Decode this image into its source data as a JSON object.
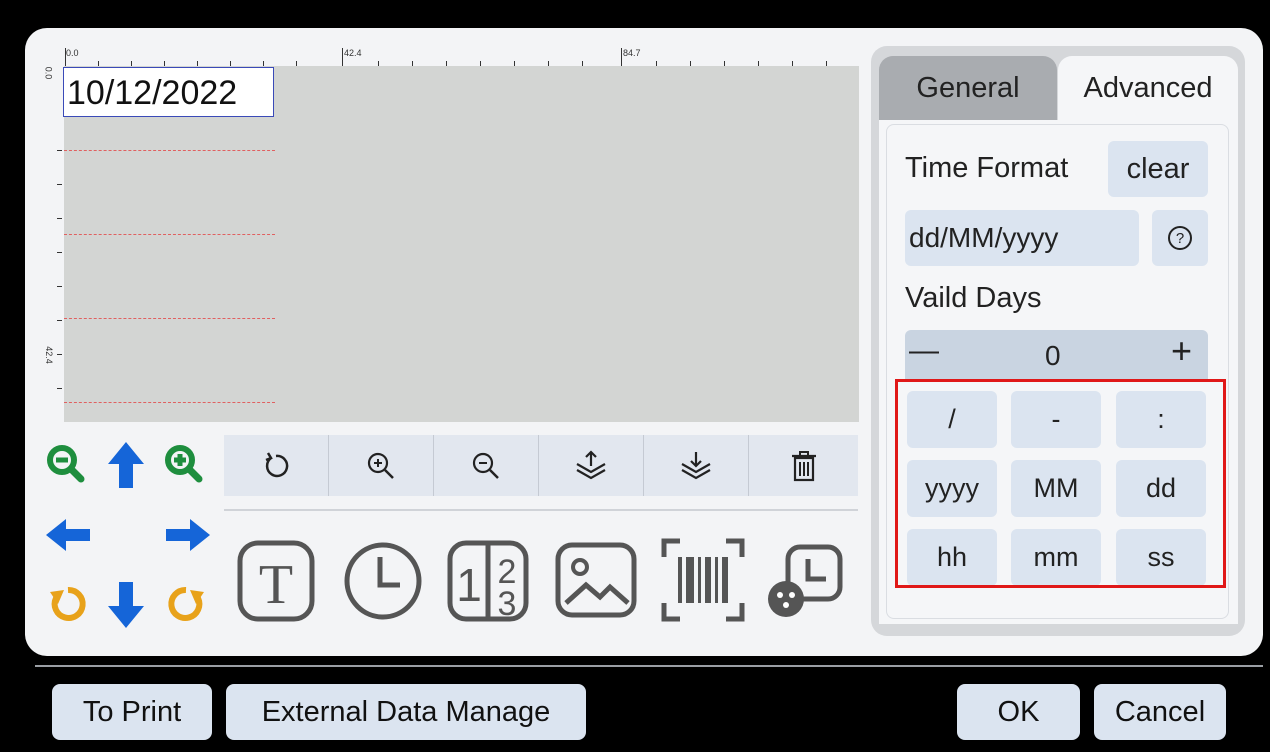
{
  "ruler": {
    "top_labels": [
      "0.0",
      "42.4",
      "84.7"
    ],
    "left_labels": [
      "0.0",
      "42.4"
    ]
  },
  "canvas": {
    "date_text": "10/12/2022"
  },
  "tabs": {
    "general": "General",
    "advanced": "Advanced"
  },
  "advanced": {
    "time_format_label": "Time Format",
    "clear_label": "clear",
    "format_value": "dd/MM/yyyy",
    "help_symbol": "?",
    "valid_days_label": "Vaild Days",
    "stepper_minus": "—",
    "stepper_value": "0",
    "stepper_plus": "+",
    "buttons": [
      [
        "/",
        "-",
        ":"
      ],
      [
        "yyyy",
        "MM",
        "dd"
      ],
      [
        "hh",
        "mm",
        "ss"
      ]
    ]
  },
  "toolbar_icons": [
    "rotate-icon",
    "zoom-in-icon",
    "zoom-out-icon",
    "layer-up-icon",
    "layer-down-icon",
    "delete-icon"
  ],
  "element_icons": [
    "text-icon",
    "clock-icon",
    "counter-icon",
    "image-icon",
    "barcode-icon",
    "datetime-icon"
  ],
  "colors": {
    "green": "#1e8e3e",
    "blue": "#1565d8",
    "orange": "#e8a21a",
    "highlight": "#e01818"
  },
  "bottom": {
    "to_print": "To Print",
    "external_data": "External Data Manage",
    "ok": "OK",
    "cancel": "Cancel"
  }
}
